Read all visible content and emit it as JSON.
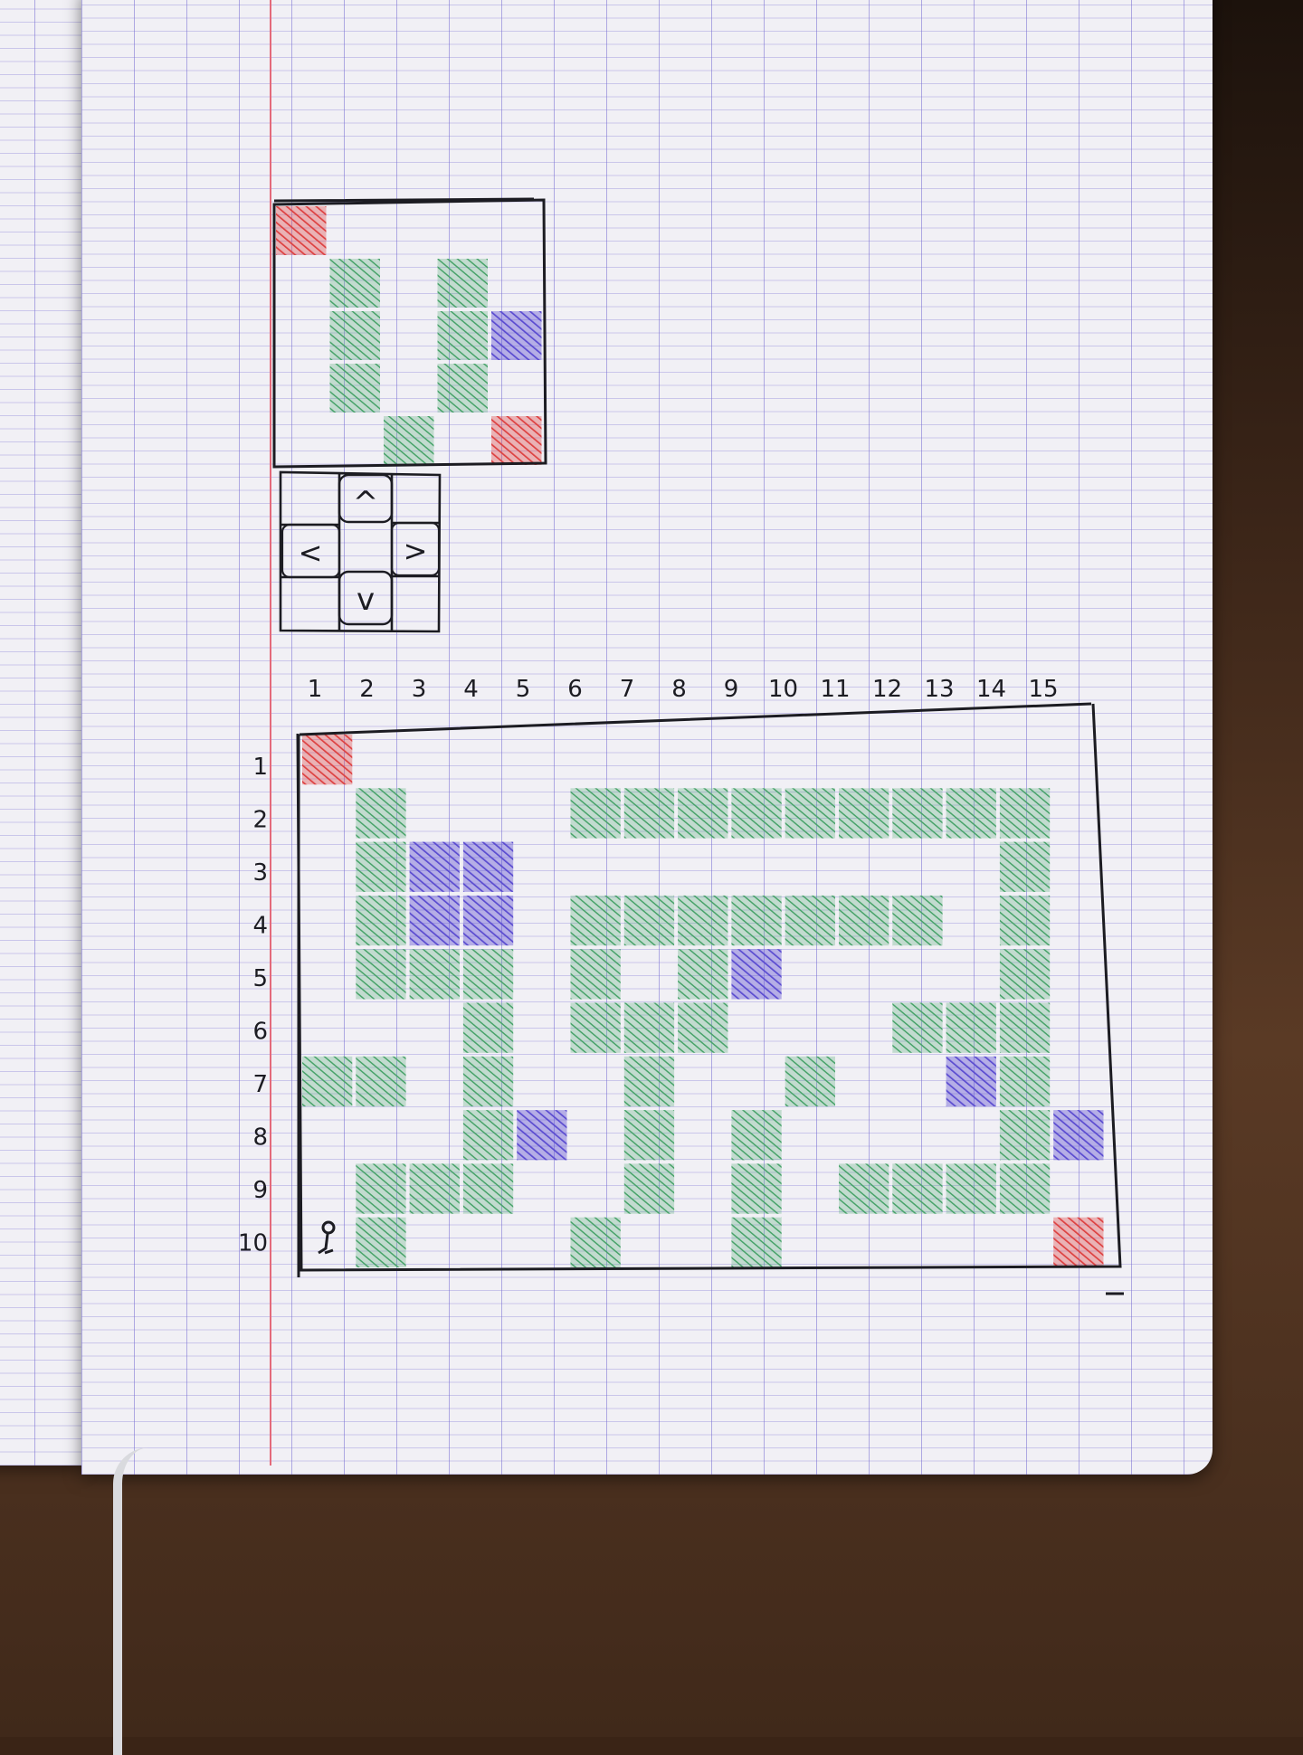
{
  "column_labels": [
    "1",
    "2",
    "3",
    "4",
    "5",
    "6",
    "7",
    "8",
    "9",
    "10",
    "11",
    "12",
    "13",
    "14",
    "15"
  ],
  "row_labels": [
    "1",
    "2",
    "3",
    "4",
    "5",
    "6",
    "7",
    "8",
    "9",
    "10"
  ],
  "controls": {
    "up": "^",
    "left": "<",
    "right": ">",
    "down": "v"
  },
  "colors": {
    "green": "#48a36a",
    "red": "#dd4040",
    "blue": "#5a4bd0",
    "ink": "#1c1c22"
  },
  "small_grid": {
    "cols": 5,
    "rows": 5,
    "cells": [
      {
        "c": 1,
        "r": 1,
        "color": "red"
      },
      {
        "c": 2,
        "r": 2,
        "color": "green"
      },
      {
        "c": 4,
        "r": 2,
        "color": "green"
      },
      {
        "c": 2,
        "r": 3,
        "color": "green"
      },
      {
        "c": 4,
        "r": 3,
        "color": "green"
      },
      {
        "c": 5,
        "r": 3,
        "color": "blue"
      },
      {
        "c": 2,
        "r": 4,
        "color": "green"
      },
      {
        "c": 4,
        "r": 4,
        "color": "green"
      },
      {
        "c": 3,
        "r": 5,
        "color": "green"
      },
      {
        "c": 5,
        "r": 5,
        "color": "red"
      }
    ]
  },
  "large_grid": {
    "cols": 15,
    "rows": 10,
    "cells": [
      {
        "c": 1,
        "r": 1,
        "color": "red"
      },
      {
        "c": 2,
        "r": 2,
        "color": "green"
      },
      {
        "c": 6,
        "r": 2,
        "color": "green"
      },
      {
        "c": 7,
        "r": 2,
        "color": "green"
      },
      {
        "c": 8,
        "r": 2,
        "color": "green"
      },
      {
        "c": 9,
        "r": 2,
        "color": "green"
      },
      {
        "c": 10,
        "r": 2,
        "color": "green"
      },
      {
        "c": 11,
        "r": 2,
        "color": "green"
      },
      {
        "c": 12,
        "r": 2,
        "color": "green"
      },
      {
        "c": 13,
        "r": 2,
        "color": "green"
      },
      {
        "c": 14,
        "r": 2,
        "color": "green"
      },
      {
        "c": 2,
        "r": 3,
        "color": "green"
      },
      {
        "c": 3,
        "r": 3,
        "color": "blue"
      },
      {
        "c": 4,
        "r": 3,
        "color": "blue"
      },
      {
        "c": 14,
        "r": 3,
        "color": "green"
      },
      {
        "c": 2,
        "r": 4,
        "color": "green"
      },
      {
        "c": 3,
        "r": 4,
        "color": "blue"
      },
      {
        "c": 4,
        "r": 4,
        "color": "blue"
      },
      {
        "c": 6,
        "r": 4,
        "color": "green"
      },
      {
        "c": 7,
        "r": 4,
        "color": "green"
      },
      {
        "c": 8,
        "r": 4,
        "color": "green"
      },
      {
        "c": 9,
        "r": 4,
        "color": "green"
      },
      {
        "c": 10,
        "r": 4,
        "color": "green"
      },
      {
        "c": 11,
        "r": 4,
        "color": "green"
      },
      {
        "c": 12,
        "r": 4,
        "color": "green"
      },
      {
        "c": 14,
        "r": 4,
        "color": "green"
      },
      {
        "c": 2,
        "r": 5,
        "color": "green"
      },
      {
        "c": 3,
        "r": 5,
        "color": "green"
      },
      {
        "c": 4,
        "r": 5,
        "color": "green"
      },
      {
        "c": 6,
        "r": 5,
        "color": "green"
      },
      {
        "c": 8,
        "r": 5,
        "color": "green"
      },
      {
        "c": 9,
        "r": 5,
        "color": "blue"
      },
      {
        "c": 14,
        "r": 5,
        "color": "green"
      },
      {
        "c": 4,
        "r": 6,
        "color": "green"
      },
      {
        "c": 6,
        "r": 6,
        "color": "green"
      },
      {
        "c": 7,
        "r": 6,
        "color": "green"
      },
      {
        "c": 8,
        "r": 6,
        "color": "green"
      },
      {
        "c": 12,
        "r": 6,
        "color": "green"
      },
      {
        "c": 13,
        "r": 6,
        "color": "green"
      },
      {
        "c": 14,
        "r": 6,
        "color": "green"
      },
      {
        "c": 1,
        "r": 7,
        "color": "green"
      },
      {
        "c": 2,
        "r": 7,
        "color": "green"
      },
      {
        "c": 4,
        "r": 7,
        "color": "green"
      },
      {
        "c": 7,
        "r": 7,
        "color": "green"
      },
      {
        "c": 10,
        "r": 7,
        "color": "green"
      },
      {
        "c": 13,
        "r": 7,
        "color": "blue"
      },
      {
        "c": 14,
        "r": 7,
        "color": "green"
      },
      {
        "c": 4,
        "r": 8,
        "color": "green"
      },
      {
        "c": 5,
        "r": 8,
        "color": "blue"
      },
      {
        "c": 7,
        "r": 8,
        "color": "green"
      },
      {
        "c": 9,
        "r": 8,
        "color": "green"
      },
      {
        "c": 14,
        "r": 8,
        "color": "green"
      },
      {
        "c": 15,
        "r": 8,
        "color": "blue"
      },
      {
        "c": 2,
        "r": 9,
        "color": "green"
      },
      {
        "c": 3,
        "r": 9,
        "color": "green"
      },
      {
        "c": 4,
        "r": 9,
        "color": "green"
      },
      {
        "c": 7,
        "r": 9,
        "color": "green"
      },
      {
        "c": 9,
        "r": 9,
        "color": "green"
      },
      {
        "c": 11,
        "r": 9,
        "color": "green"
      },
      {
        "c": 12,
        "r": 9,
        "color": "green"
      },
      {
        "c": 13,
        "r": 9,
        "color": "green"
      },
      {
        "c": 14,
        "r": 9,
        "color": "green"
      },
      {
        "c": 2,
        "r": 10,
        "color": "green"
      },
      {
        "c": 6,
        "r": 10,
        "color": "green"
      },
      {
        "c": 9,
        "r": 10,
        "color": "green"
      },
      {
        "c": 15,
        "r": 10,
        "color": "red"
      }
    ],
    "player": {
      "c": 1,
      "r": 10
    }
  }
}
